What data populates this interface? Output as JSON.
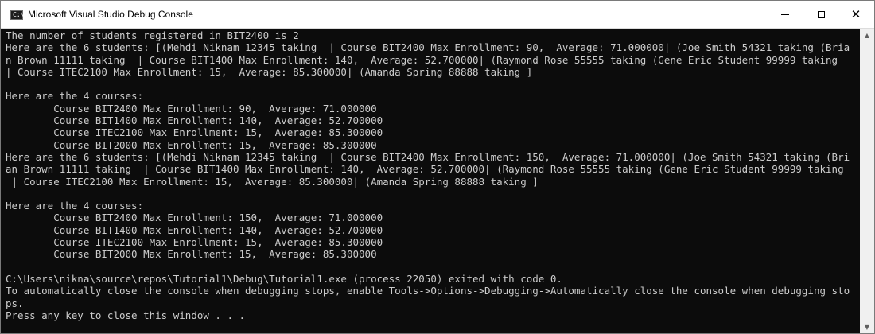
{
  "window": {
    "title": "Microsoft Visual Studio Debug Console",
    "icon": "console-app-icon",
    "icon_glyph": "C:\\"
  },
  "controls": {
    "minimize": "minimize-icon",
    "maximize": "maximize-icon",
    "close_glyph": "✕"
  },
  "console": {
    "lines": [
      "The number of students registered in BIT2400 is 2",
      "Here are the 6 students: [(Mehdi Niknam 12345 taking  | Course BIT2400 Max Enrollment: 90,  Average: 71.000000| (Joe Smith 54321 taking (Bria",
      "n Brown 11111 taking  | Course BIT1400 Max Enrollment: 140,  Average: 52.700000| (Raymond Rose 55555 taking (Gene Eric Student 99999 taking",
      "| Course ITEC2100 Max Enrollment: 15,  Average: 85.300000| (Amanda Spring 88888 taking ]",
      "",
      "Here are the 4 courses:",
      "        Course BIT2400 Max Enrollment: 90,  Average: 71.000000",
      "        Course BIT1400 Max Enrollment: 140,  Average: 52.700000",
      "        Course ITEC2100 Max Enrollment: 15,  Average: 85.300000",
      "        Course BIT2000 Max Enrollment: 15,  Average: 85.300000",
      "Here are the 6 students: [(Mehdi Niknam 12345 taking  | Course BIT2400 Max Enrollment: 150,  Average: 71.000000| (Joe Smith 54321 taking (Bri",
      "an Brown 11111 taking  | Course BIT1400 Max Enrollment: 140,  Average: 52.700000| (Raymond Rose 55555 taking (Gene Eric Student 99999 taking",
      " | Course ITEC2100 Max Enrollment: 15,  Average: 85.300000| (Amanda Spring 88888 taking ]",
      "",
      "Here are the 4 courses:",
      "        Course BIT2400 Max Enrollment: 150,  Average: 71.000000",
      "        Course BIT1400 Max Enrollment: 140,  Average: 52.700000",
      "        Course ITEC2100 Max Enrollment: 15,  Average: 85.300000",
      "        Course BIT2000 Max Enrollment: 15,  Average: 85.300000",
      "",
      "C:\\Users\\nikna\\source\\repos\\Tutorial1\\Debug\\Tutorial1.exe (process 22050) exited with code 0.",
      "To automatically close the console when debugging stops, enable Tools->Options->Debugging->Automatically close the console when debugging sto",
      "ps.",
      "Press any key to close this window . . ."
    ]
  },
  "scrollbar": {
    "up_glyph": "▲",
    "down_glyph": "▼"
  },
  "colors": {
    "console_bg": "#0c0c0c",
    "console_fg": "#cccccc",
    "titlebar_bg": "#ffffff"
  }
}
